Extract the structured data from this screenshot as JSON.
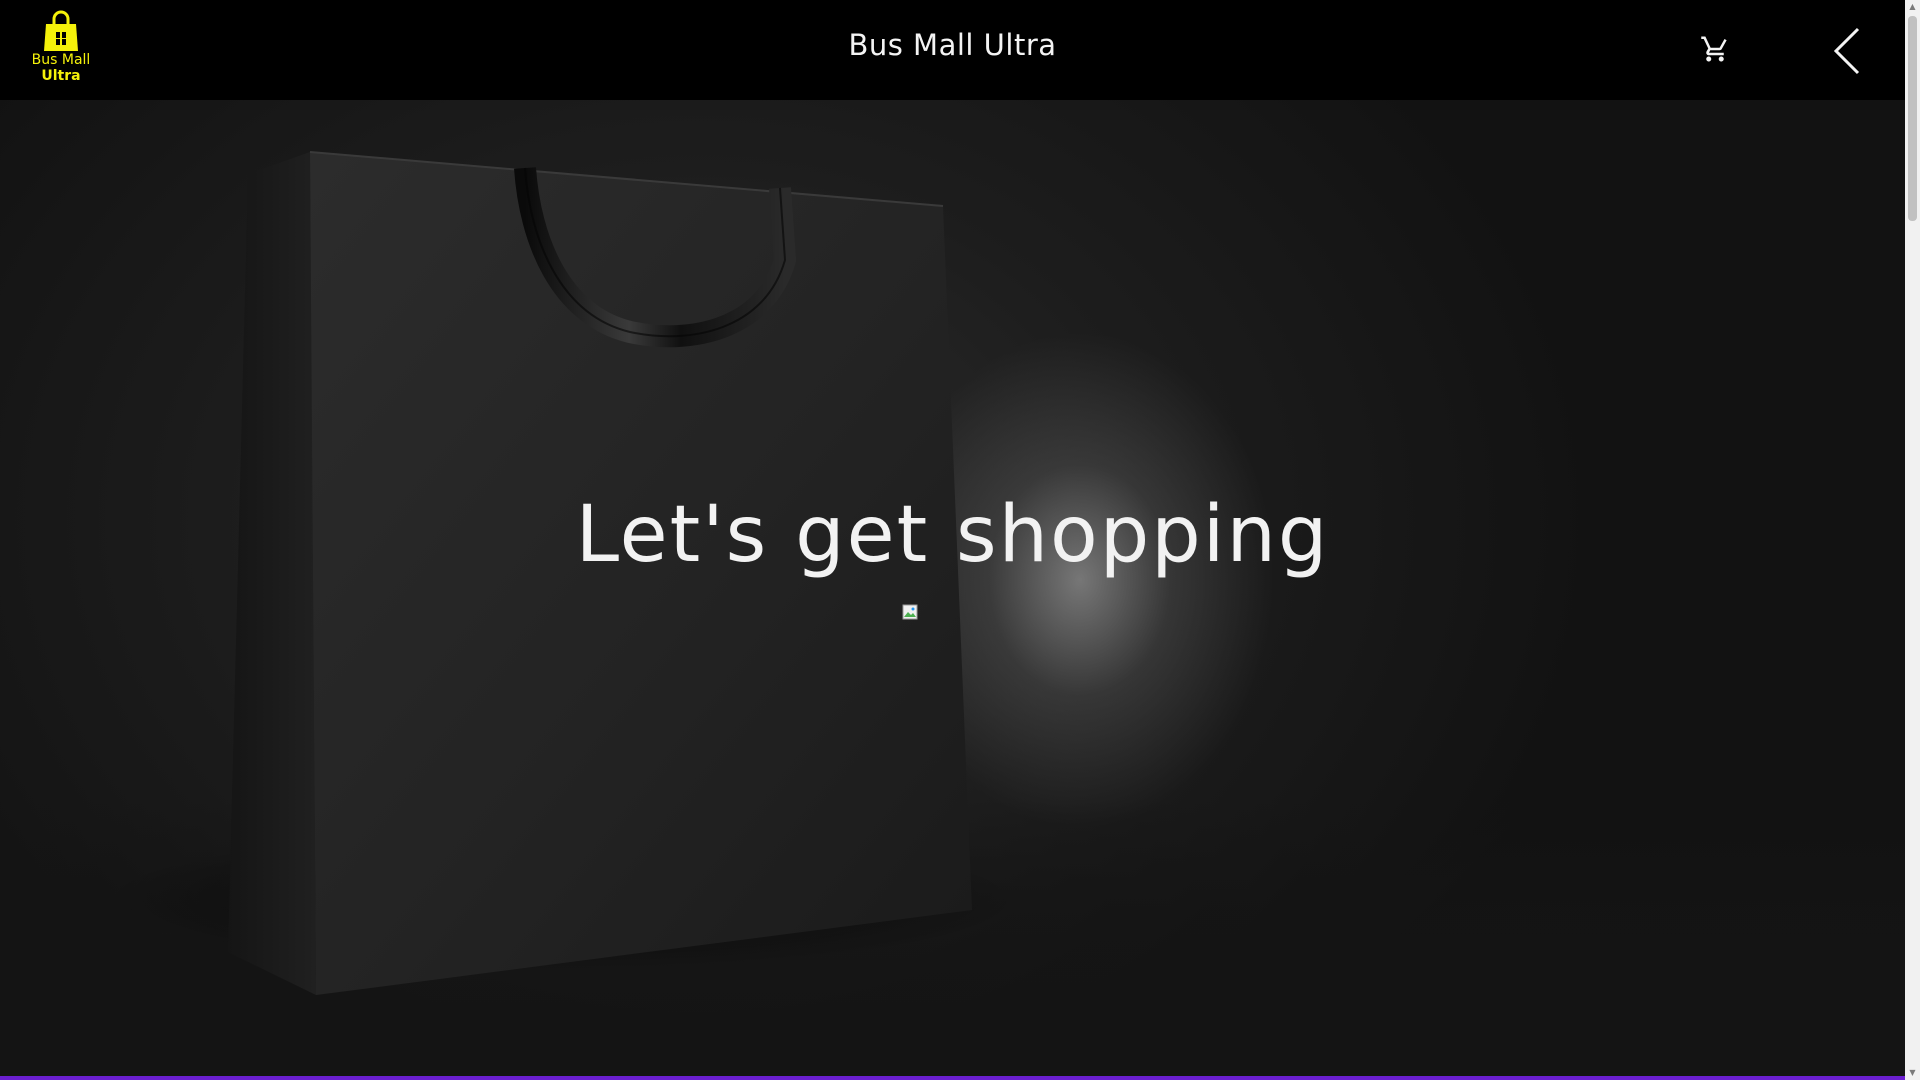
{
  "header": {
    "logo_line1": "Bus Mall",
    "logo_line2": "Ultra",
    "title": "Bus Mall Ultra",
    "cart_icon": "cart-icon",
    "back_icon": "chevron-left-icon"
  },
  "hero": {
    "heading": "Let's get shopping",
    "image_icon": "broken-image-icon"
  },
  "colors": {
    "header_bg": "#000000",
    "logo_accent": "#f5f20a",
    "bottom_bar": "#6b1fd0"
  }
}
